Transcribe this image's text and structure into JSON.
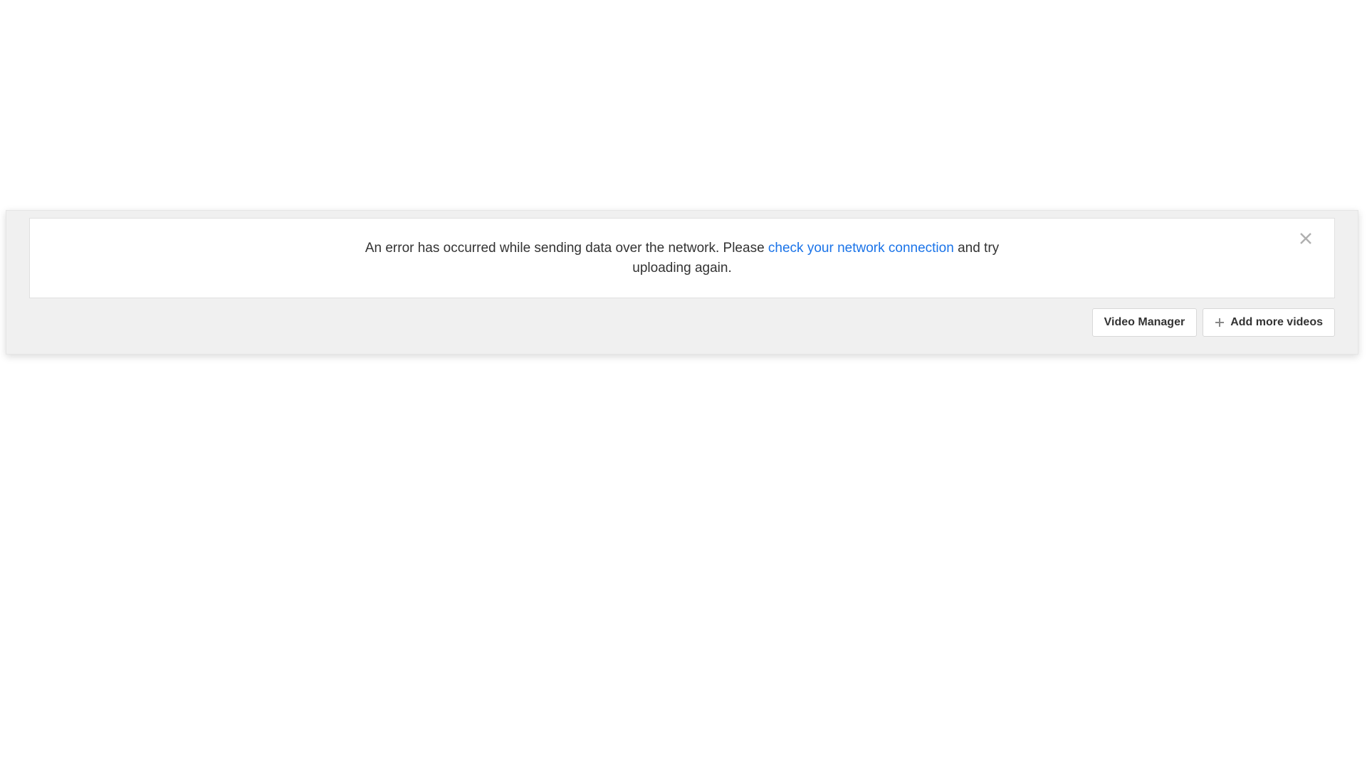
{
  "alert": {
    "message_prefix": "An error has occurred while sending data over the network. Please ",
    "link_text": "check your network connection",
    "message_suffix": " and try uploading again."
  },
  "buttons": {
    "video_manager": "Video Manager",
    "add_more_videos": "Add more videos"
  }
}
